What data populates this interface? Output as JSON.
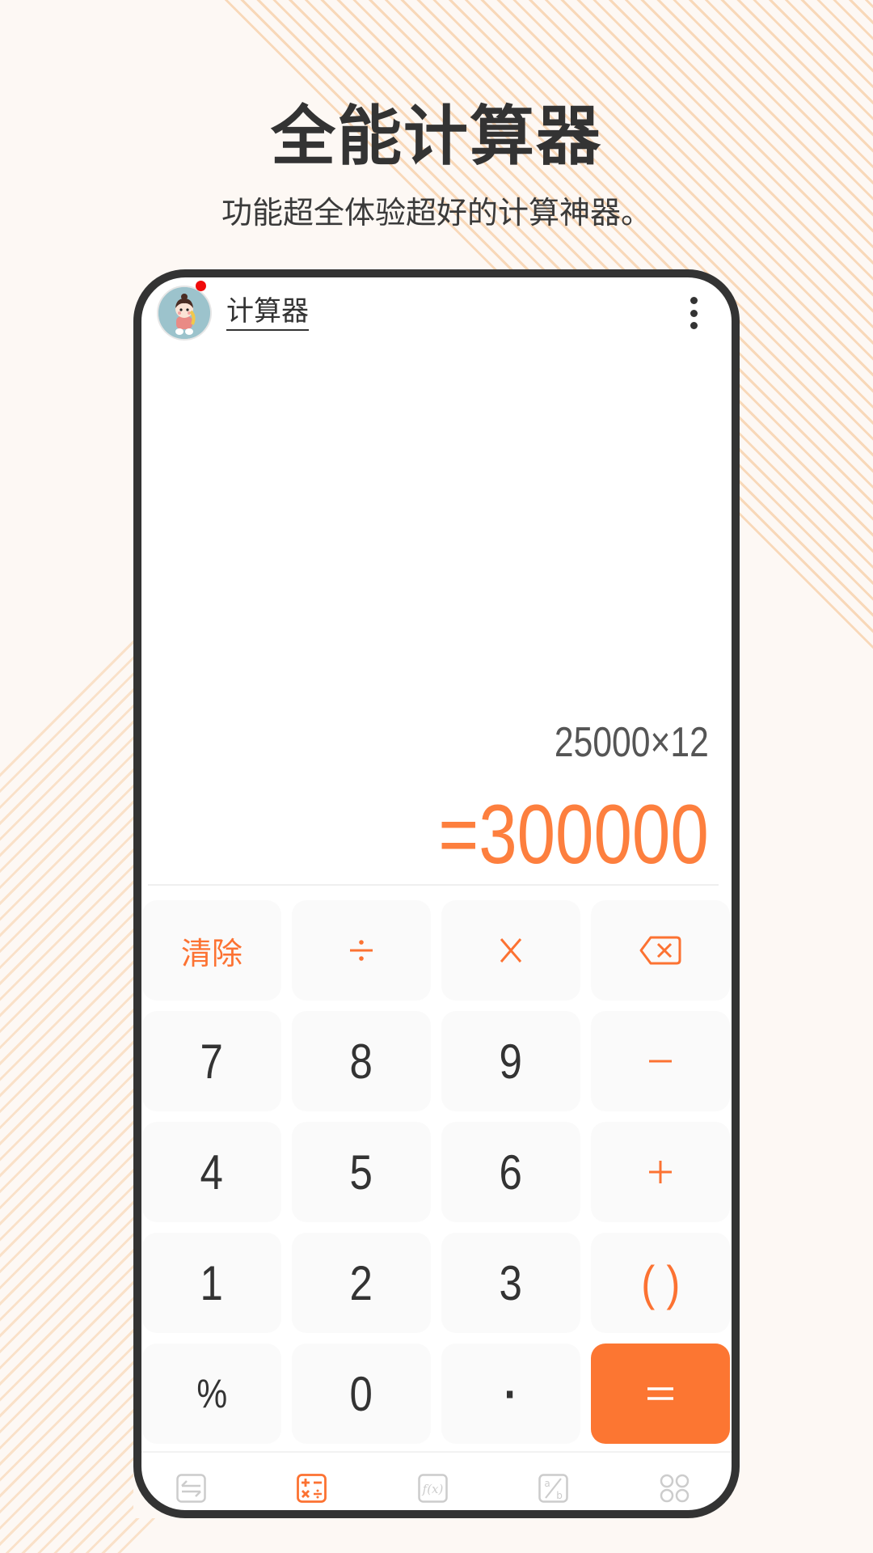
{
  "promo": {
    "title": "全能计算器",
    "subtitle": "功能超全体验超好的计算神器。"
  },
  "app": {
    "title": "计算器",
    "avatar": "baby-avatar",
    "notification_dot": true,
    "menu_icon": "more-vertical-icon"
  },
  "display": {
    "expression": "25000×12",
    "result": "=300000"
  },
  "keypad": {
    "rows": [
      [
        {
          "label": "清除",
          "type": "clear"
        },
        {
          "label": "÷",
          "type": "op"
        },
        {
          "label": "×",
          "type": "op"
        },
        {
          "label": "",
          "icon": "backspace-icon",
          "type": "op"
        }
      ],
      [
        {
          "label": "7",
          "type": "digit"
        },
        {
          "label": "8",
          "type": "digit"
        },
        {
          "label": "9",
          "type": "digit"
        },
        {
          "label": "−",
          "type": "op"
        }
      ],
      [
        {
          "label": "4",
          "type": "digit"
        },
        {
          "label": "5",
          "type": "digit"
        },
        {
          "label": "6",
          "type": "digit"
        },
        {
          "label": "+",
          "type": "op"
        }
      ],
      [
        {
          "label": "1",
          "type": "digit"
        },
        {
          "label": "2",
          "type": "digit"
        },
        {
          "label": "3",
          "type": "digit"
        },
        {
          "label": "( )",
          "type": "op"
        }
      ],
      [
        {
          "label": "%",
          "type": "digit"
        },
        {
          "label": "0",
          "type": "digit"
        },
        {
          "label": "·",
          "type": "digit"
        },
        {
          "label": "=",
          "type": "equals"
        }
      ]
    ]
  },
  "bottom_nav": {
    "items": [
      {
        "icon": "unit-convert-icon",
        "active": false
      },
      {
        "icon": "calculator-icon",
        "active": true
      },
      {
        "icon": "function-icon",
        "active": false
      },
      {
        "icon": "fraction-icon",
        "active": false
      },
      {
        "icon": "more-apps-icon",
        "active": false
      }
    ]
  },
  "colors": {
    "accent": "#fc7632",
    "result": "#fd7f3e",
    "inactive_icon": "#cccccc",
    "text": "#333333",
    "background": "#fdf8f4"
  }
}
